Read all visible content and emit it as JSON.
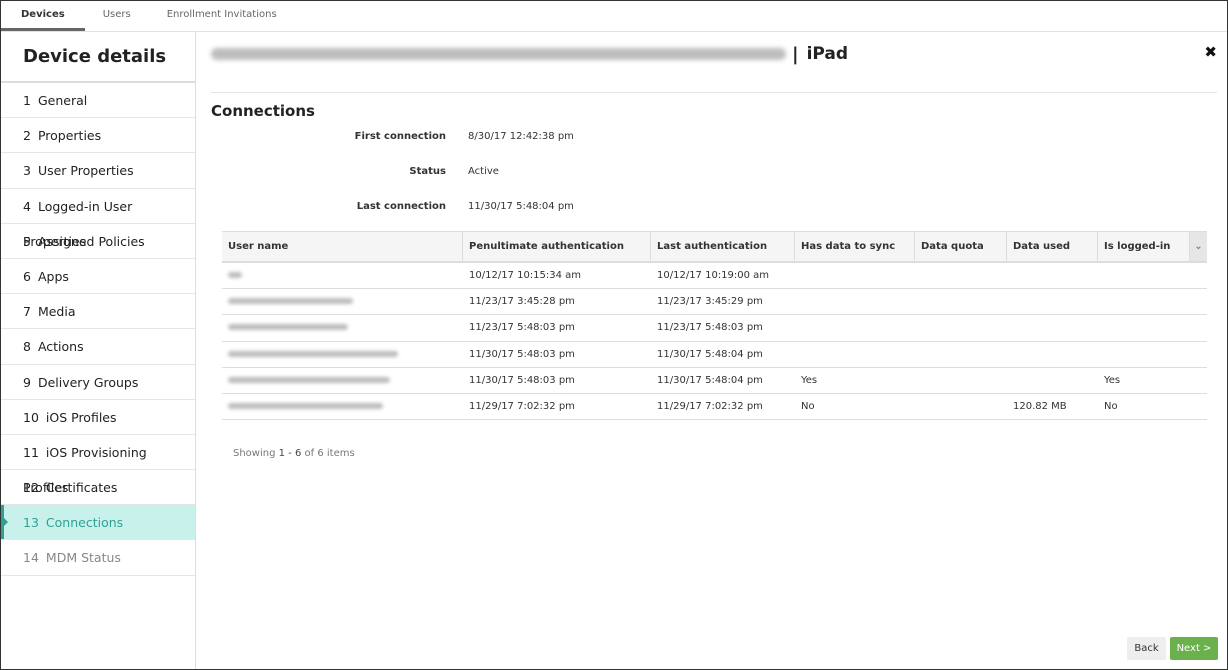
{
  "top_tabs": [
    {
      "label": "Devices",
      "active": true
    },
    {
      "label": "Users",
      "active": false
    },
    {
      "label": "Enrollment Invitations",
      "active": false
    }
  ],
  "sidebar": {
    "title": "Device details",
    "items": [
      {
        "num": "1",
        "label": "General"
      },
      {
        "num": "2",
        "label": "Properties"
      },
      {
        "num": "3",
        "label": "User Properties"
      },
      {
        "num": "4",
        "label": "Logged-in User Properties"
      },
      {
        "num": "5",
        "label": "Assigned Policies"
      },
      {
        "num": "6",
        "label": "Apps"
      },
      {
        "num": "7",
        "label": "Media"
      },
      {
        "num": "8",
        "label": "Actions"
      },
      {
        "num": "9",
        "label": "Delivery Groups"
      },
      {
        "num": "10",
        "label": "iOS Profiles"
      },
      {
        "num": "11",
        "label": "iOS Provisioning Profiles"
      },
      {
        "num": "12",
        "label": "Certificates"
      },
      {
        "num": "13",
        "label": "Connections",
        "active": true
      },
      {
        "num": "14",
        "label": "MDM Status",
        "disabled": true
      }
    ]
  },
  "header": {
    "separator": "|",
    "device_type": "iPad",
    "close_icon": "close-icon"
  },
  "section": {
    "title": "Connections",
    "first_connection_label": "First connection",
    "first_connection_value": "8/30/17 12:42:38 pm",
    "status_label": "Status",
    "status_value": "Active",
    "last_connection_label": "Last connection",
    "last_connection_value": "11/30/17 5:48:04 pm"
  },
  "table": {
    "columns": [
      "User name",
      "Penultimate authentication",
      "Last authentication",
      "Has data to sync",
      "Data quota",
      "Data used",
      "Is logged-in"
    ],
    "menu_icon": "chevron-down-icon",
    "rows": [
      {
        "user": "",
        "penultimate": "10/12/17 10:15:34 am",
        "last": "10/12/17 10:19:00 am",
        "sync": "",
        "quota": "",
        "used": "",
        "logged": ""
      },
      {
        "user": "",
        "penultimate": "11/23/17 3:45:28 pm",
        "last": "11/23/17 3:45:29 pm",
        "sync": "",
        "quota": "",
        "used": "",
        "logged": ""
      },
      {
        "user": "",
        "penultimate": "11/23/17 5:48:03 pm",
        "last": "11/23/17 5:48:03 pm",
        "sync": "",
        "quota": "",
        "used": "",
        "logged": ""
      },
      {
        "user": "",
        "penultimate": "11/30/17 5:48:03 pm",
        "last": "11/30/17 5:48:04 pm",
        "sync": "",
        "quota": "",
        "used": "",
        "logged": ""
      },
      {
        "user": "",
        "penultimate": "11/30/17 5:48:03 pm",
        "last": "11/30/17 5:48:04 pm",
        "sync": "Yes",
        "quota": "",
        "used": "",
        "logged": "Yes"
      },
      {
        "user": "",
        "penultimate": "11/29/17 7:02:32 pm",
        "last": "11/29/17 7:02:32 pm",
        "sync": "No",
        "quota": "",
        "used": "120.82 MB",
        "logged": "No"
      }
    ],
    "showing_prefix": "Showing",
    "showing_range": "1 - 6",
    "showing_suffix": "of 6 items"
  },
  "footer": {
    "back_label": "Back",
    "next_label": "Next >"
  }
}
